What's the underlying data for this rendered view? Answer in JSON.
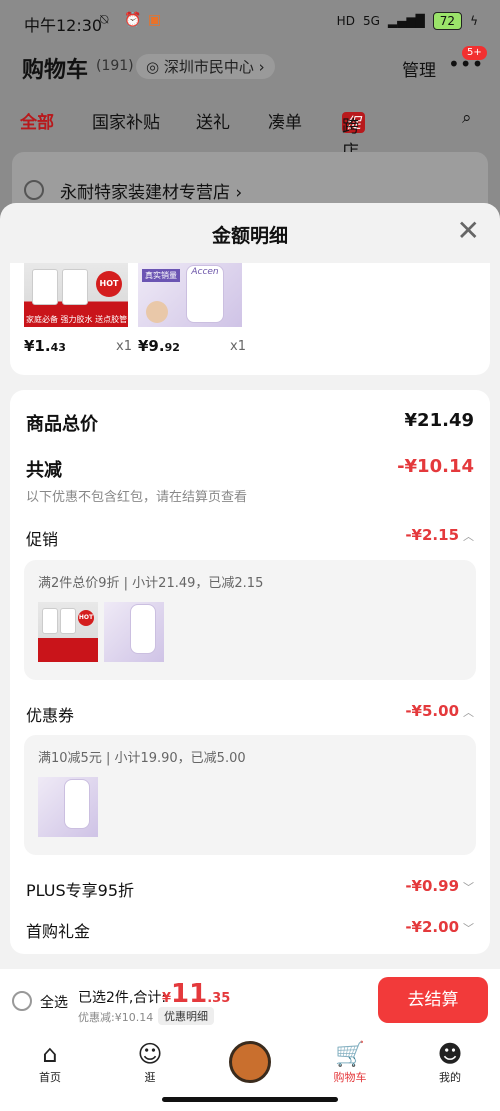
{
  "status": {
    "time": "中午12:30",
    "signal": "5G",
    "battery": "72"
  },
  "header": {
    "title": "购物车",
    "count": "(191)",
    "location": "深圳市民中心",
    "manage": "管理",
    "badge": "5+"
  },
  "tabs": [
    "全部",
    "国家补贴",
    "送礼",
    "凑单",
    "跨店满减"
  ],
  "promo_tag": "促",
  "store": {
    "name": "永耐特家装建材专营店"
  },
  "sheet": {
    "title": "金额明细"
  },
  "products": [
    {
      "price_int": "¥1.",
      "price_dec": "43",
      "qty": "x1",
      "badge": "HOT",
      "strip": "家庭必备 强力胶水 送点胶管"
    },
    {
      "price_int": "¥9.",
      "price_dec": "92",
      "qty": "x1",
      "brand": "Accen",
      "tag": "真实销量"
    }
  ],
  "summary": {
    "goods_total_label": "商品总价",
    "goods_total": "¥21.49",
    "discount_label": "共减",
    "discount": "-¥10.14",
    "discount_note": "以下优惠不包含红包，请在结算页查看",
    "promo_label": "促销",
    "promo_value": "-¥2.15",
    "promo_desc": "满2件总价9折 | 小计21.49，已减2.15",
    "coupon_label": "优惠券",
    "coupon_value": "-¥5.00",
    "coupon_desc": "满10减5元 | 小计19.90，已减5.00",
    "plus_label": "PLUS专享95折",
    "plus_value": "-¥0.99",
    "first_label": "首购礼金",
    "first_value": "-¥2.00"
  },
  "bottom": {
    "select_all": "全选",
    "selected": "已选2件,合计:",
    "yen": "¥",
    "total_int": "11",
    "total_dec": ".35",
    "saved": "优惠减:¥10.14",
    "detail": "优惠明细",
    "checkout": "去结算"
  },
  "nav": {
    "home": "首页",
    "browse": "逛",
    "cart": "购物车",
    "mine": "我的"
  },
  "colors": {
    "accent": "#e4393c",
    "checkout": "#f23a3a"
  }
}
